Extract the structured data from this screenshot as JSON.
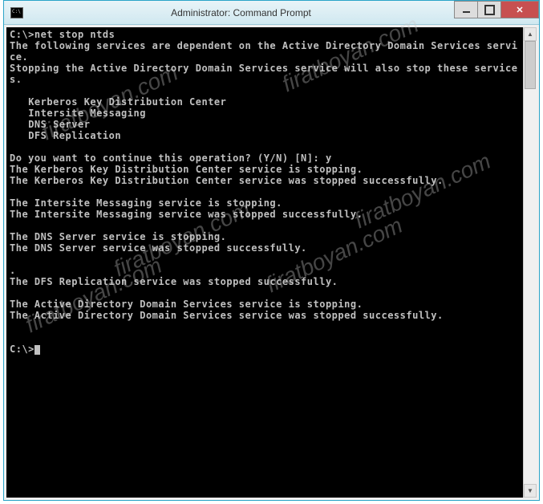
{
  "window": {
    "title": "Administrator: Command Prompt"
  },
  "terminal": {
    "prompt1": "C:\\>",
    "command": "net stop ntds",
    "line_deps": "The following services are dependent on the Active Directory Domain Services service.",
    "line_stop_warn": "Stopping the Active Directory Domain Services service will also stop these services.",
    "svc1": "   Kerberos Key Distribution Center",
    "svc2": "   Intersite Messaging",
    "svc3": "   DNS Server",
    "svc4": "   DFS Replication",
    "confirm_prompt": "Do you want to continue this operation? (Y/N) [N]: ",
    "confirm_answer": "y",
    "kdc_stopping": "The Kerberos Key Distribution Center service is stopping.",
    "kdc_stopped": "The Kerberos Key Distribution Center service was stopped successfully.",
    "ism_stopping": "The Intersite Messaging service is stopping.",
    "ism_stopped": "The Intersite Messaging service was stopped successfully.",
    "dns_stopping": "The DNS Server service is stopping.",
    "dns_stopped": "The DNS Server service was stopped successfully.",
    "dot": ".",
    "dfs_stopped": "The DFS Replication service was stopped successfully.",
    "ad_stopping": "The Active Directory Domain Services service is stopping.",
    "ad_stopped": "The Active Directory Domain Services service was stopped successfully.",
    "prompt2": "C:\\>"
  },
  "watermark": "firatboyan.com"
}
